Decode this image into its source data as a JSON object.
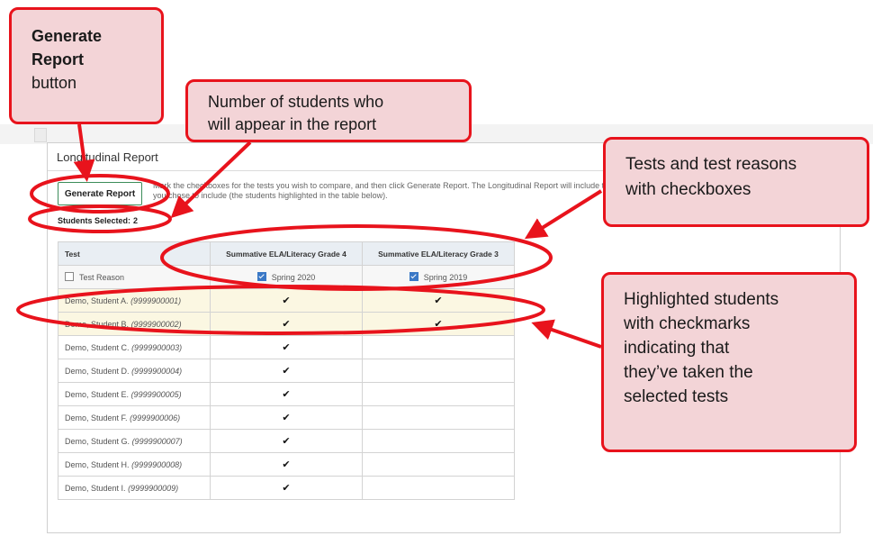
{
  "panel": {
    "title": "Longitudinal Report",
    "generate_label": "Generate Report",
    "instructions": "Mark the checkboxes for the tests you wish to compare, and then click Generate Report. The Longitudinal Report will include the students you chose to include (the students highlighted in the table below).",
    "selected_label": "Students Selected:",
    "selected_count": "2"
  },
  "table": {
    "headers": [
      "Test",
      "Summative ELA/Literacy Grade 4",
      "Summative ELA/Literacy Grade 3"
    ],
    "reason_label": "Test Reason",
    "reasons": [
      "Spring 2020",
      "Spring 2019"
    ],
    "rows": [
      {
        "name": "Demo, Student A.",
        "id": "(9999900001)",
        "t1": "✔",
        "t2": "✔",
        "highlight": true
      },
      {
        "name": "Demo, Student B.",
        "id": "(9999900002)",
        "t1": "✔",
        "t2": "✔",
        "highlight": true
      },
      {
        "name": "Demo, Student C.",
        "id": "(9999900003)",
        "t1": "✔",
        "t2": "",
        "highlight": false
      },
      {
        "name": "Demo, Student D.",
        "id": "(9999900004)",
        "t1": "✔",
        "t2": "",
        "highlight": false
      },
      {
        "name": "Demo, Student E.",
        "id": "(9999900005)",
        "t1": "✔",
        "t2": "",
        "highlight": false
      },
      {
        "name": "Demo, Student F.",
        "id": "(9999900006)",
        "t1": "✔",
        "t2": "",
        "highlight": false
      },
      {
        "name": "Demo, Student G.",
        "id": "(9999900007)",
        "t1": "✔",
        "t2": "",
        "highlight": false
      },
      {
        "name": "Demo, Student H.",
        "id": "(9999900008)",
        "t1": "✔",
        "t2": "",
        "highlight": false
      },
      {
        "name": "Demo, Student I.",
        "id": "(9999900009)",
        "t1": "✔",
        "t2": "",
        "highlight": false
      }
    ]
  },
  "callouts": {
    "generate_line1": "Generate",
    "generate_line2": "Report",
    "generate_line3": "button",
    "number_line1": "Number of students who",
    "number_line2": "will appear in the report",
    "tests_line1": "Tests and test reasons",
    "tests_line2": "with checkboxes",
    "highlight_line1": "Highlighted students",
    "highlight_line2": "with checkmarks",
    "highlight_line3": "indicating that",
    "highlight_line4": "they’ve taken the",
    "highlight_line5": "selected tests"
  },
  "colors": {
    "callout_fill": "#f3d4d7",
    "callout_border": "#e8131c",
    "highlight_row": "#fbf7e2",
    "checkbox_on": "#3a78c6"
  }
}
